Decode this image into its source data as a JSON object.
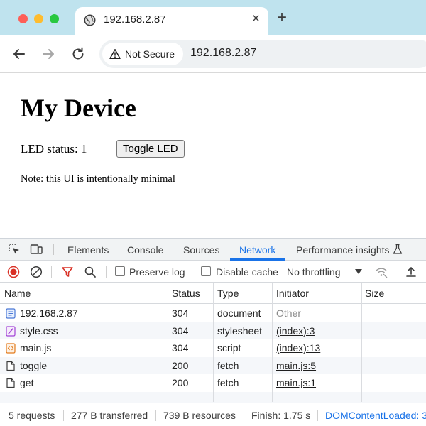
{
  "browser": {
    "tab_title": "192.168.2.87",
    "tab_close": "×",
    "new_tab": "+",
    "security_label": "Not Secure",
    "url": "192.168.2.87"
  },
  "page": {
    "title": "My Device",
    "led_status": "LED status: 1",
    "toggle_label": "Toggle LED",
    "note": "Note: this UI is intentionally minimal"
  },
  "devtools": {
    "tabs": [
      "Elements",
      "Console",
      "Sources",
      "Network",
      "Performance insights"
    ],
    "active_tab": "Network",
    "filter": {
      "preserve_log": "Preserve log",
      "disable_cache": "Disable cache",
      "throttling": "No throttling"
    },
    "columns": [
      "Name",
      "Status",
      "Type",
      "Initiator",
      "Size"
    ],
    "rows": [
      {
        "name": "192.168.2.87",
        "status": "304",
        "type": "document",
        "initiator": "Other",
        "icon": "document-icon"
      },
      {
        "name": "style.css",
        "status": "304",
        "type": "stylesheet",
        "initiator": "(index):3",
        "icon": "stylesheet-icon"
      },
      {
        "name": "main.js",
        "status": "304",
        "type": "script",
        "initiator": "(index):13",
        "icon": "script-icon"
      },
      {
        "name": "toggle",
        "status": "200",
        "type": "fetch",
        "initiator": "main.js:5",
        "icon": "fetch-icon"
      },
      {
        "name": "get",
        "status": "200",
        "type": "fetch",
        "initiator": "main.js:1",
        "icon": "fetch-icon"
      }
    ],
    "summary": {
      "requests": "5 requests",
      "transferred": "277 B transferred",
      "resources": "739 B resources",
      "finish": "Finish: 1.75 s",
      "dom_loaded": "DOMContentLoaded: 3"
    }
  },
  "colors": {
    "tabstrip": "#bfe3ee",
    "accent": "#1a73e8",
    "record": "#d93025"
  }
}
